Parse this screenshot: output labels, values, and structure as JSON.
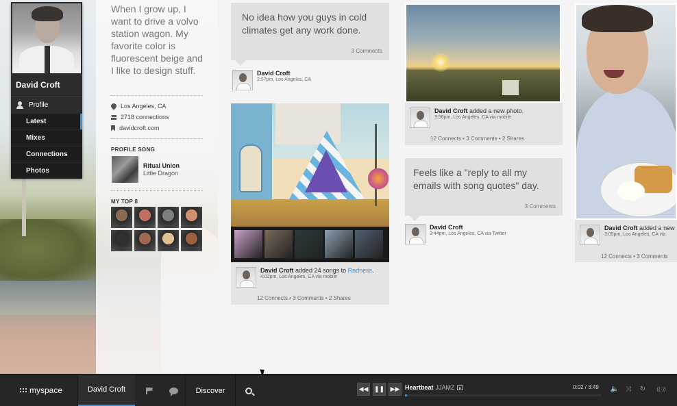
{
  "profile": {
    "name": "David Croft",
    "profile_link": "Profile",
    "nav": [
      "Latest",
      "Mixes",
      "Connections",
      "Photos"
    ],
    "active_nav": "Latest"
  },
  "bio": {
    "text": "When I grow up, I want to drive a volvo station wagon. My favorite color is fluorescent beige and I like to design stuff.",
    "location": "Los Angeles, CA",
    "connections": "2718 connections",
    "website": "davidcroft.com"
  },
  "profile_song": {
    "heading": "PROFILE SONG",
    "title": "Ritual Union",
    "artist": "Little Dragon"
  },
  "top8": {
    "heading": "MY TOP 8",
    "friends": [
      "#8a6a50",
      "#c07060",
      "#7a8080",
      "#d09070",
      "#303030",
      "#a06850",
      "#e0c090",
      "#9a6040"
    ]
  },
  "feed": {
    "status1": {
      "text": "No idea how you guys in cold climates get any work done.",
      "comments": "3 Comments",
      "author": "David Croft",
      "meta": "2:57pm, Los Angeles, CA"
    },
    "mural_post": {
      "author": "David Croft",
      "action": "added 24 songs to",
      "link": "Radness",
      "link_suffix": ".",
      "meta": "4:02pm, Los Angeles, CA via mobile",
      "connects": "12 Connects",
      "comments": "3 Comments",
      "shares": "2 Shares",
      "albums": [
        "#c8a0c8",
        "#7a6a5a",
        "#2a3a3a",
        "#8aa0b0",
        "#506070"
      ]
    },
    "sunset_post": {
      "author": "David Croft",
      "action": "added a new photo.",
      "meta": "3:56pm, Los Angeles, CA via mobile",
      "connects": "12 Connects",
      "comments": "3 Comments",
      "shares": "2 Shares"
    },
    "status2": {
      "text": "Feels like a \"reply to all my emails with song quotes\" day.",
      "comments": "3 Comments",
      "author": "David Croft",
      "meta": "3:44pm, Los Angeles, CA via Twitter"
    },
    "portrait_post": {
      "author": "David Croft",
      "action": "added a new",
      "meta": "3:05pm, Los Angeles, CA via",
      "connects": "12 Connects",
      "comments": "3 Comments"
    },
    "separator": "•"
  },
  "bottom_bar": {
    "logo": "myspace",
    "user_tab": "David Croft",
    "discover": "Discover",
    "prev": "◀◀",
    "pause": "❚❚",
    "next": "▶▶",
    "track": "Heartbeat",
    "artist": "JJAMZ",
    "time": "0:02 / 3:49",
    "progress": 0.01,
    "volume_icon": "🔈",
    "shuffle_icon": "⤨",
    "repeat_icon": "↻",
    "radio_icon": "((·))"
  },
  "colors": {
    "accent": "#3c8fd4",
    "dark_bar": "#262626",
    "card_bg": "#e4e4e4"
  }
}
